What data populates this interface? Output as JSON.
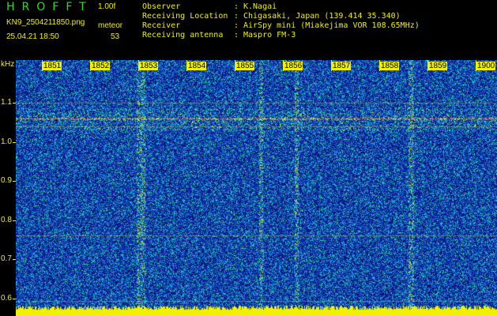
{
  "header": {
    "app_title": "HROFFT",
    "version": "1.00f",
    "file_name": "KN9_2504211850.png",
    "meteor_label": "meteor",
    "date_time": "25.04.21 18:50",
    "meteor_count": "53"
  },
  "info": [
    {
      "label": "Observer",
      "sep": ":",
      "value": "K.Nagai"
    },
    {
      "label": "Receiving Location",
      "sep": ":",
      "value": "Chigasaki, Japan (139.414 35.340)"
    },
    {
      "label": "Receiver",
      "sep": ":",
      "value": "AirSpy mini (Miakejima VOR 108.65MHz)"
    },
    {
      "label": "Receiving antenna",
      "sep": ":",
      "value": "Maspro FM-3"
    }
  ],
  "axes": {
    "y_unit": "kHz",
    "y_ticks": [
      "1.1",
      "1.0",
      "0.9",
      "0.8",
      "0.7",
      "0.6"
    ],
    "x_ticks": [
      "1851",
      "1852",
      "1853",
      "1854",
      "1855",
      "1856",
      "1857",
      "1858",
      "1859",
      "1900"
    ]
  },
  "colors": {
    "background": "#000000",
    "label_text": "#f0f000",
    "title_text": "#22e022",
    "spectrogram_base": "#1a2f9a"
  }
}
